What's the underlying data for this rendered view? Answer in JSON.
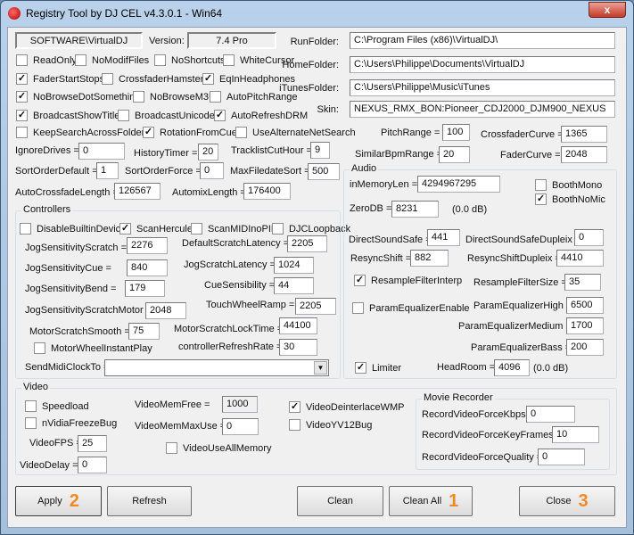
{
  "window": {
    "title": "Registry Tool by DJ CEL v4.3.0.1 - Win64",
    "close": "x"
  },
  "top": {
    "registry_key": "SOFTWARE\\VirtualDJ",
    "version_label": "Version:",
    "version": "7.4 Pro",
    "run_label": "RunFolder:",
    "run": "C:\\Program Files (x86)\\VirtualDJ\\",
    "home_label": "HomeFolder:",
    "home": "C:\\Users\\Philippe\\Documents\\VirtualDJ",
    "itunes_label": "iTunesFolder:",
    "itunes": "C:\\Users\\Philippe\\Music\\iTunes",
    "skin_label": "Skin:",
    "skin": "NEXUS_RMX_BON:Pioneer_CDJ2000_DJM900_NEXUS"
  },
  "checks": [
    {
      "label": "ReadOnly",
      "checked": false
    },
    {
      "label": "NoModifFiles",
      "checked": false
    },
    {
      "label": "NoShortcuts",
      "checked": false
    },
    {
      "label": "WhiteCursor",
      "checked": false
    },
    {
      "label": "FaderStartStops",
      "checked": true
    },
    {
      "label": "CrossfaderHamster",
      "checked": false
    },
    {
      "label": "EqInHeadphones",
      "checked": true
    },
    {
      "label": "NoBrowseDotSomething",
      "checked": true
    },
    {
      "label": "NoBrowseM3U",
      "checked": false
    },
    {
      "label": "AutoPitchRange",
      "checked": false
    },
    {
      "label": "BroadcastShowTitles",
      "checked": true
    },
    {
      "label": "BroadcastUnicode",
      "checked": false
    },
    {
      "label": "AutoRefreshDRM",
      "checked": true
    },
    {
      "label": "KeepSearchAcrossFolders",
      "checked": false
    },
    {
      "label": "RotationFromCue",
      "checked": true
    },
    {
      "label": "UseAlternateNetSearch",
      "checked": false
    }
  ],
  "fields": {
    "ignore_drives": {
      "label": "IgnoreDrives =",
      "value": "0"
    },
    "history_timer": {
      "label": "HistoryTimer =",
      "value": "20"
    },
    "tracklist_cut_hour": {
      "label": "TracklistCutHour =",
      "value": "9"
    },
    "sort_order_default": {
      "label": "SortOrderDefault =",
      "value": "1"
    },
    "sort_order_force": {
      "label": "SortOrderForce =",
      "value": "0"
    },
    "max_filedate_sort": {
      "label": "MaxFiledateSort =",
      "value": "500"
    },
    "auto_crossfade_length": {
      "label": "AutoCrossfadeLength =",
      "value": "126567"
    },
    "automix_length": {
      "label": "AutomixLength =",
      "value": "176400"
    },
    "pitch_range": {
      "label": "PitchRange =",
      "value": "100"
    },
    "crossfader_curve": {
      "label": "CrossfaderCurve =",
      "value": "1365"
    },
    "similar_bpm_range": {
      "label": "SimilarBpmRange =",
      "value": "20"
    },
    "fader_curve": {
      "label": "FaderCurve =",
      "value": "2048"
    }
  },
  "controllers": {
    "title": "Controllers",
    "checks": [
      {
        "label": "DisableBuiltinDevices",
        "checked": false
      },
      {
        "label": "ScanHercules",
        "checked": true
      },
      {
        "label": "ScanMIDInoPID",
        "checked": false
      },
      {
        "label": "DJCLoopback",
        "checked": false
      },
      {
        "label": "MotorWheelInstantPlay",
        "checked": false
      }
    ],
    "jss": {
      "label": "JogSensitivityScratch =",
      "value": "2276"
    },
    "dsl": {
      "label": "DefaultScratchLatency =",
      "value": "2205"
    },
    "jsc": {
      "label": "JogSensitivityCue =",
      "value": "840"
    },
    "jsl": {
      "label": "JogScratchLatency =",
      "value": "1024"
    },
    "jsb": {
      "label": "JogSensitivityBend =",
      "value": "179"
    },
    "cue": {
      "label": "CueSensibility =",
      "value": "44"
    },
    "jssm": {
      "label": "JogSensitivityScratchMotor =",
      "value": "2048"
    },
    "twr": {
      "label": "TouchWheelRamp =",
      "value": "2205"
    },
    "mss": {
      "label": "MotorScratchSmooth =",
      "value": "75"
    },
    "mslt": {
      "label": "MotorScratchLockTime =",
      "value": "44100"
    },
    "crr": {
      "label": "controllerRefreshRate =",
      "value": "30"
    },
    "midi": {
      "label": "SendMidiClockTo =",
      "value": ""
    }
  },
  "audio": {
    "title": "Audio",
    "iml": {
      "label": "inMemoryLen =",
      "value": "4294967295"
    },
    "booth_mono": {
      "label": "BoothMono",
      "checked": false
    },
    "booth_nomic": {
      "label": "BoothNoMic",
      "checked": true
    },
    "zerodb": {
      "label": "ZeroDB =",
      "value": "8231",
      "db": "(0.0 dB)"
    },
    "dss": {
      "label": "DirectSoundSafe =",
      "value": "441"
    },
    "dssd": {
      "label": "DirectSoundSafeDupleix =",
      "value": "0"
    },
    "rs": {
      "label": "ResyncShift =",
      "value": "882"
    },
    "rsd": {
      "label": "ResyncShiftDupleix =",
      "value": "4410"
    },
    "rfi": {
      "label": "ResampleFilterInterp",
      "checked": true
    },
    "rfs": {
      "label": "ResampleFilterSize =",
      "value": "35"
    },
    "pee": {
      "label": "ParamEqualizerEnable",
      "checked": false
    },
    "peh": {
      "label": "ParamEqualizerHigh =",
      "value": "6500"
    },
    "pem": {
      "label": "ParamEqualizerMedium =",
      "value": "1700"
    },
    "peb": {
      "label": "ParamEqualizerBass =",
      "value": "200"
    },
    "limiter": {
      "label": "Limiter",
      "checked": true
    },
    "headroom": {
      "label": "HeadRoom =",
      "value": "4096",
      "db": "(0.0 dB)"
    }
  },
  "video": {
    "title": "Video",
    "speedload": {
      "label": "Speedload",
      "checked": false
    },
    "nvidia": {
      "label": "nVidiaFreezeBug",
      "checked": false
    },
    "fps": {
      "label": "VideoFPS =",
      "value": "25"
    },
    "delay": {
      "label": "VideoDelay =",
      "value": "0"
    },
    "memfree": {
      "label": "VideoMemFree =",
      "value": "1000"
    },
    "memmax": {
      "label": "VideoMemMaxUse =",
      "value": "0"
    },
    "allmem": {
      "label": "VideoUseAllMemory",
      "checked": false
    },
    "deint": {
      "label": "VideoDeinterlaceWMP",
      "checked": true
    },
    "yv12": {
      "label": "VideoYV12Bug",
      "checked": false
    },
    "recorder": {
      "title": "Movie Recorder",
      "kbps": {
        "label": "RecordVideoForceKbps =",
        "value": "0"
      },
      "keyframes": {
        "label": "RecordVideoForceKeyFrames =",
        "value": "10"
      },
      "quality": {
        "label": "RecordVideoForceQuality =",
        "value": "0"
      }
    }
  },
  "buttons": {
    "apply": "Apply",
    "apply_num": "2",
    "refresh": "Refresh",
    "clean": "Clean",
    "clean_all": "Clean All",
    "clean_all_num": "1",
    "close": "Close",
    "close_num": "3"
  },
  "colors": {
    "annotation": "#f08a24"
  }
}
